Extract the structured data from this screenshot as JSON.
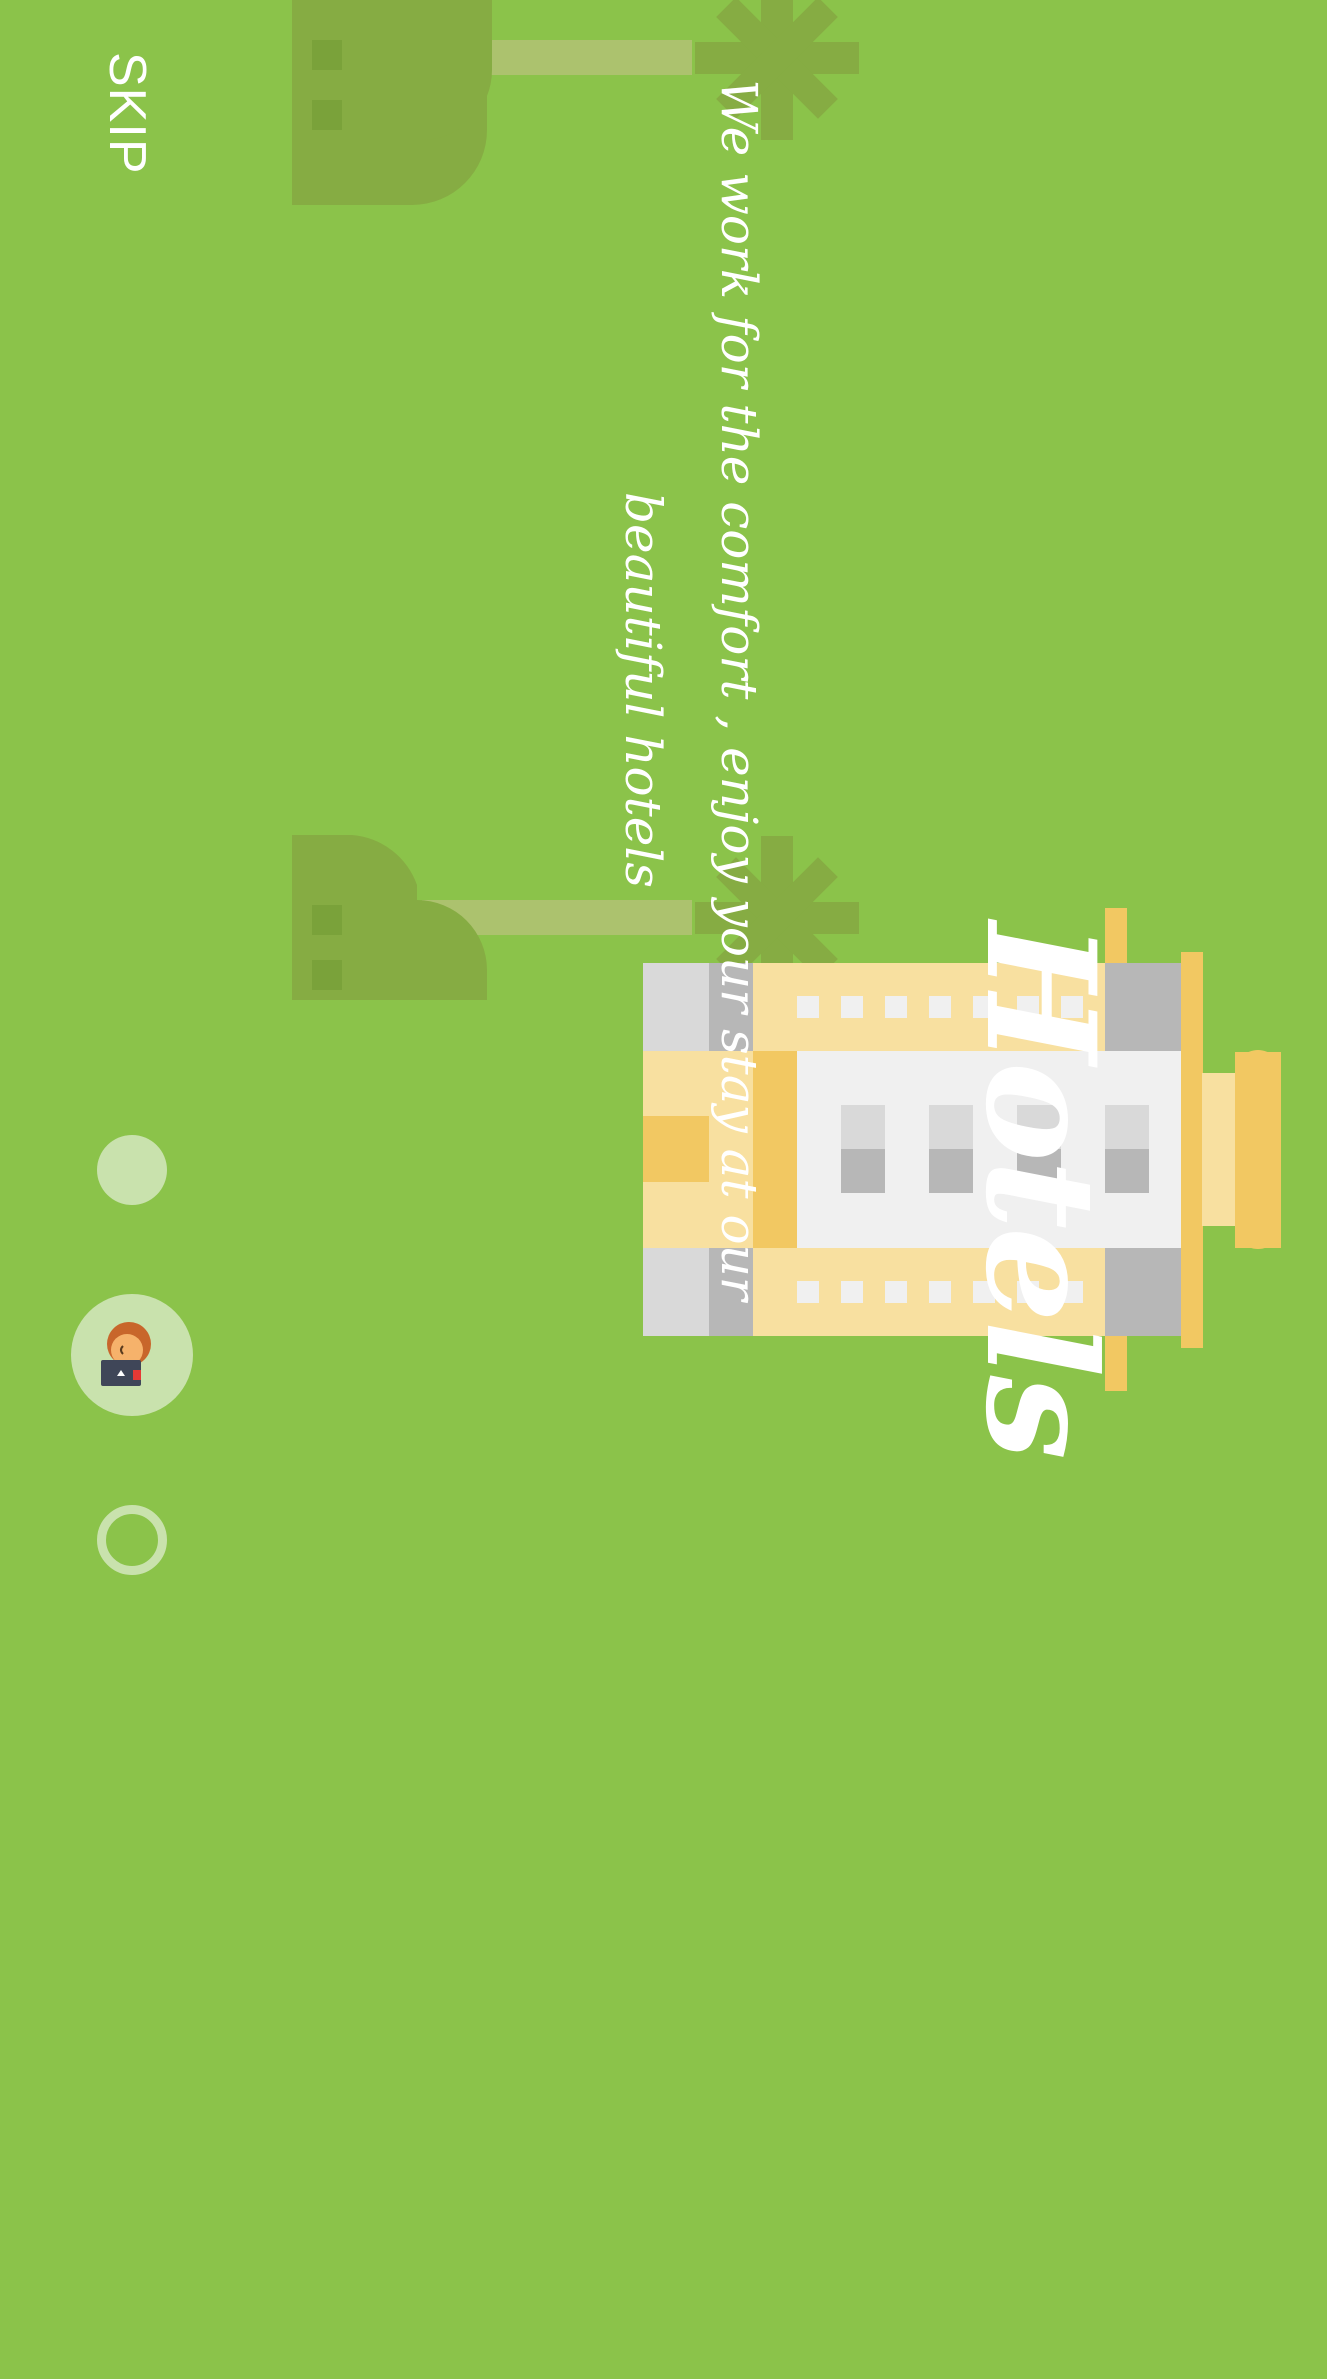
{
  "onboarding": {
    "title": "Hotels",
    "subtitle": "We work for the comfort , enjoy your stay at our beautiful hotels",
    "skip_label": "SKIP"
  },
  "pager": {
    "page_count": 3,
    "current_page": 2,
    "current_page_icon": "receptionist-avatar-icon"
  },
  "illustration": {
    "name": "hotel-building-illustration",
    "icons": [
      "palm-tree-icon",
      "bush-icon",
      "hotel-building-icon"
    ]
  },
  "colors": {
    "background": "#8bc34a",
    "dot": "#c9e2ad",
    "text": "#ffffff",
    "accent_yellow": "#f2c862",
    "building_light": "#f8e0a0",
    "building_white": "#f0f0f0",
    "building_gray": "#b7b7b7"
  }
}
